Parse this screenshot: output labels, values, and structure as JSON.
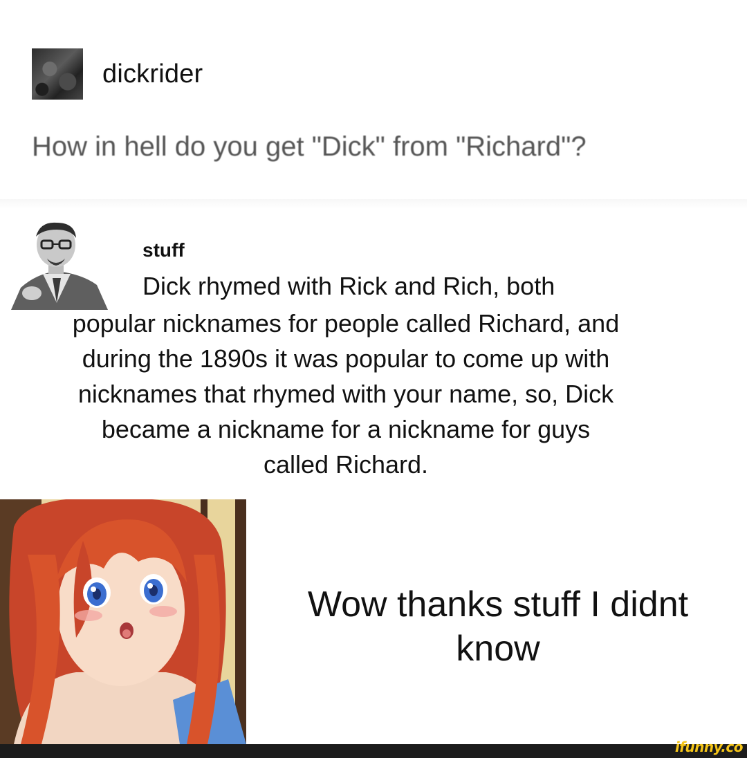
{
  "post1": {
    "username": "dickrider",
    "text": "How in hell do you get \"Dick\" from \"Richard\"?"
  },
  "post2": {
    "username": "stuff",
    "text_first_line": "Dick rhymed with Rick and Rich, both",
    "text_lines": [
      "popular nicknames for people called Richard, and",
      "during the 1890s it was popular to come up with",
      "nicknames that rhymed with your name, so, Dick",
      "became a nickname for a nickname for guys",
      "called Richard."
    ]
  },
  "reaction": {
    "line1": "Wow thanks stuff I didnt",
    "line2": "know"
  },
  "watermark": "ifunny.co",
  "colors": {
    "hair": "#d8532b",
    "footer": "#1c1c1c",
    "watermark": "#f5c518"
  }
}
